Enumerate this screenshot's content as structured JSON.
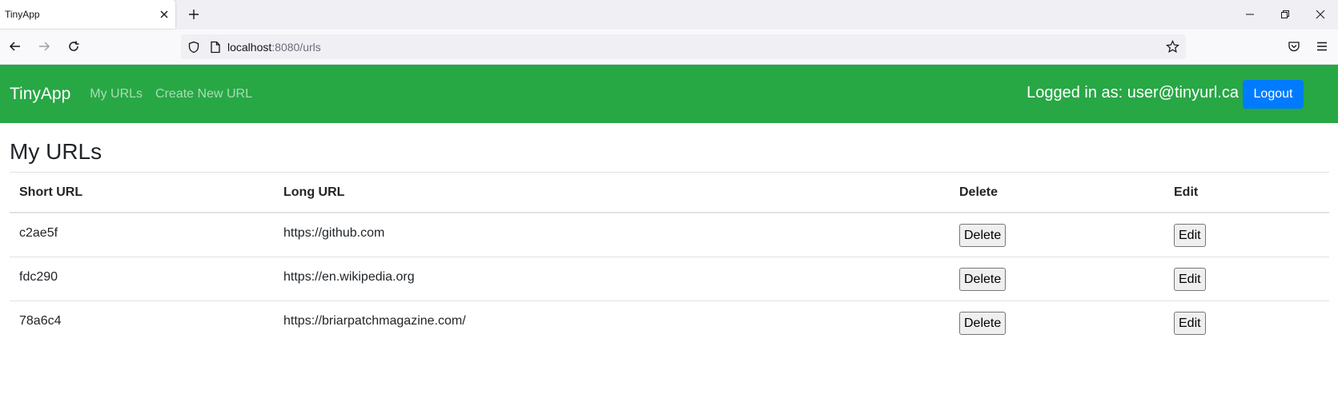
{
  "browser": {
    "tab_title": "TinyApp",
    "url_host": "localhost",
    "url_rest": ":8080/urls"
  },
  "app": {
    "brand": "TinyApp",
    "nav_links": [
      "My URLs",
      "Create New URL"
    ],
    "logged_in_text": "Logged in as: user@tinyurl.ca",
    "logout_label": "Logout",
    "colors": {
      "navbar": "#28a745",
      "logout_button": "#007bff"
    }
  },
  "page": {
    "title": "My URLs",
    "columns": [
      "Short URL",
      "Long URL",
      "Delete",
      "Edit"
    ],
    "rows": [
      {
        "short": "c2ae5f",
        "long": "https://github.com",
        "delete_label": "Delete",
        "edit_label": "Edit"
      },
      {
        "short": "fdc290",
        "long": "https://en.wikipedia.org",
        "delete_label": "Delete",
        "edit_label": "Edit"
      },
      {
        "short": "78a6c4",
        "long": "https://briarpatchmagazine.com/",
        "delete_label": "Delete",
        "edit_label": "Edit"
      }
    ]
  }
}
